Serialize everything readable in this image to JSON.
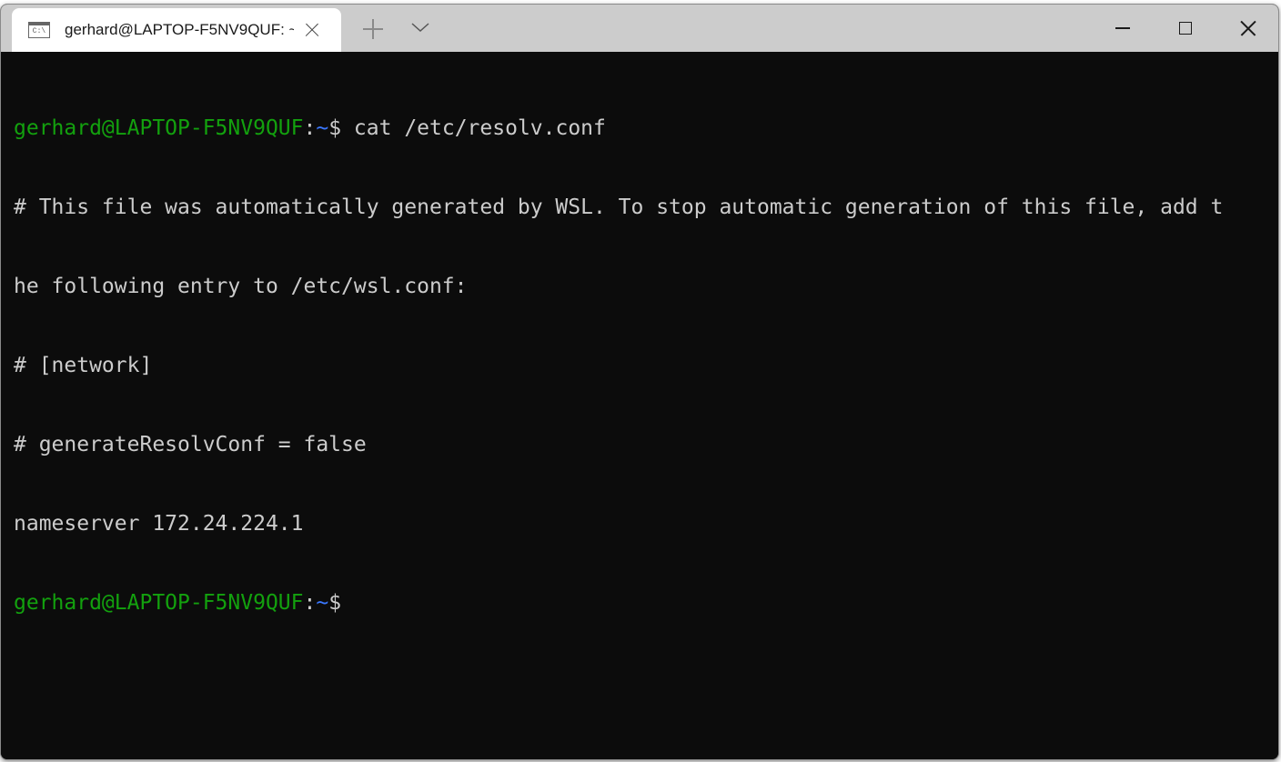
{
  "window": {
    "tab_title": "gerhard@LAPTOP-F5NV9QUF: ~",
    "tab_icon": "console-icon",
    "tab_icon_label": "C:\\",
    "controls": {
      "minimize": "minimize-icon",
      "maximize": "maximize-icon",
      "close": "close-icon"
    }
  },
  "colors": {
    "titlebar": "#cccccc",
    "tab": "#ffffff",
    "terminal_bg": "#0c0c0c",
    "prompt_user": "#13a10e",
    "prompt_path": "#3b78ff",
    "text": "#cccccc"
  },
  "terminal": {
    "prompt": {
      "user_host": "gerhard@LAPTOP-F5NV9QUF",
      "colon": ":",
      "path": "~",
      "dollar": "$"
    },
    "command": " cat /etc/resolv.conf",
    "output": [
      "# This file was automatically generated by WSL. To stop automatic generation of this file, add t",
      "he following entry to /etc/wsl.conf:",
      "# [network]",
      "# generateResolvConf = false",
      "nameserver 172.24.224.1"
    ]
  }
}
